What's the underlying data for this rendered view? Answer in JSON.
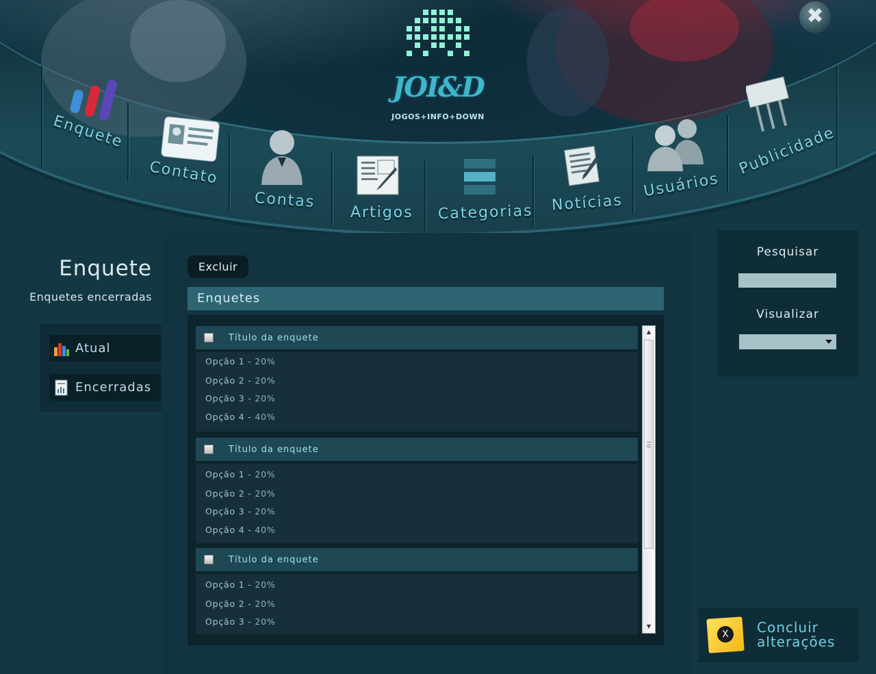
{
  "header": {
    "logo_text": "JOI&D",
    "tagline": "JOGOS+INFO+DOWN",
    "close_symbol": "✖"
  },
  "nav": [
    {
      "label": "Enquete",
      "icon": "bar-chart-icon"
    },
    {
      "label": "Contato",
      "icon": "id-card-icon"
    },
    {
      "label": "Contas",
      "icon": "user-icon"
    },
    {
      "label": "Artigos",
      "icon": "article-edit-icon"
    },
    {
      "label": "Categorias",
      "icon": "categories-icon"
    },
    {
      "label": "Notícias",
      "icon": "news-icon"
    },
    {
      "label": "Usuários",
      "icon": "users-icon"
    },
    {
      "label": "Publicidade",
      "icon": "billboard-icon"
    }
  ],
  "sidebar": {
    "title": "Enquete",
    "subtitle": "Enquetes encerradas",
    "items": [
      {
        "label": "Atual",
        "icon": "bar-chart-icon"
      },
      {
        "label": "Encerradas",
        "icon": "report-icon"
      }
    ]
  },
  "main": {
    "delete_label": "Excluir",
    "panel_title": "Enquetes",
    "polls": [
      {
        "title": "Título da enquete",
        "options": [
          {
            "name": "Opção 1",
            "sep": " - ",
            "pct": "20%"
          },
          {
            "name": "Opção 2",
            "sep": " - ",
            "pct": "20%"
          },
          {
            "name": "Opção 3",
            "sep": " - ",
            "pct": "20%"
          },
          {
            "name": "Opção 4",
            "sep": " - ",
            "pct": "40%"
          }
        ]
      },
      {
        "title": "Título da enquete",
        "options": [
          {
            "name": "Opção 1",
            "sep": " - ",
            "pct": "20%"
          },
          {
            "name": "Opção 2",
            "sep": " - ",
            "pct": "20%"
          },
          {
            "name": "Opção 3",
            "sep": " - ",
            "pct": "20%"
          },
          {
            "name": "Opção 4",
            "sep": " - ",
            "pct": "40%"
          }
        ]
      },
      {
        "title": "Título da enquete",
        "options": [
          {
            "name": "Opção 1",
            "sep": " - ",
            "pct": "20%"
          },
          {
            "name": "Opção 2",
            "sep": " - ",
            "pct": "20%"
          },
          {
            "name": "Opção 3",
            "sep": " - ",
            "pct": "20%"
          }
        ]
      }
    ]
  },
  "right": {
    "search_label": "Pesquisar",
    "search_value": "",
    "view_label": "Visualizar",
    "view_value": "",
    "finish_line1": "Concluir",
    "finish_line2": "alterações",
    "finish_icon_symbol": "X"
  },
  "colors": {
    "background": "#143843",
    "accent": "#7fd3e4",
    "panel_header": "#2d6573"
  }
}
